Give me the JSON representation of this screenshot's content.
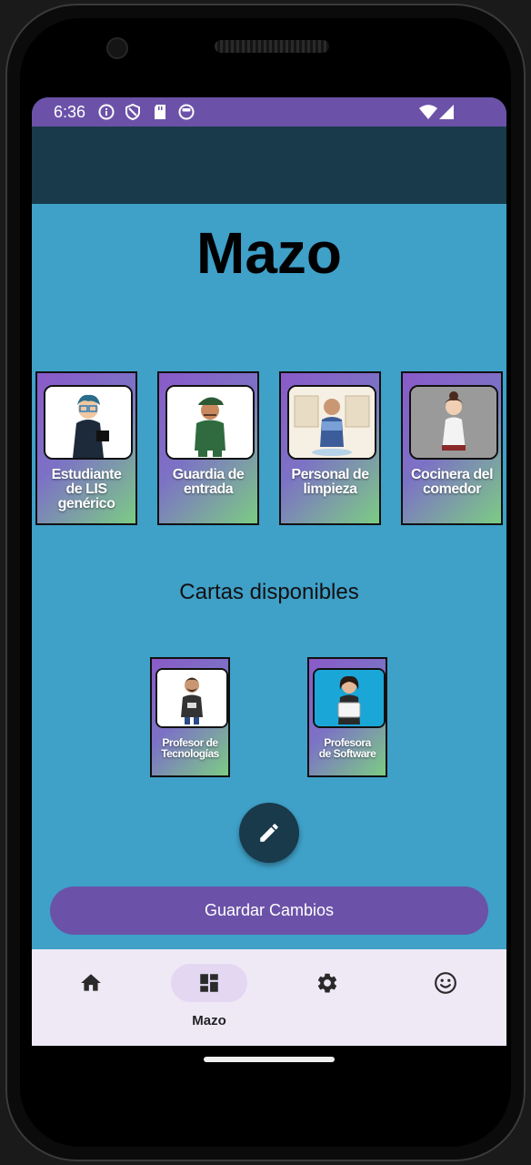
{
  "status_bar": {
    "time": "6:36"
  },
  "page": {
    "title": "Mazo",
    "available_heading": "Cartas disponibles"
  },
  "deck": [
    {
      "label_line1": "Estudiante",
      "label_line2": "de LIS",
      "label_line3": "genérico",
      "icon": "student-character"
    },
    {
      "label_line1": "Guardia de",
      "label_line2": "entrada",
      "label_line3": "",
      "icon": "guard-character"
    },
    {
      "label_line1": "Personal de",
      "label_line2": "limpieza",
      "label_line3": "",
      "icon": "cleaning-staff-character"
    },
    {
      "label_line1": "Cocinera del",
      "label_line2": "comedor",
      "label_line3": "",
      "icon": "cook-character"
    }
  ],
  "available": [
    {
      "label_line1": "Profesor de",
      "label_line2": "Tecnologías",
      "icon": "technology-professor-character"
    },
    {
      "label_line1": "Profesora",
      "label_line2": "de Software",
      "icon": "software-professor-character"
    }
  ],
  "actions": {
    "save_label": "Guardar Cambios",
    "edit_icon": "pencil-icon"
  },
  "bottom_nav": {
    "items": [
      {
        "icon": "home-icon",
        "label": ""
      },
      {
        "icon": "dashboard-icon",
        "label": "Mazo",
        "active": true
      },
      {
        "icon": "gear-icon",
        "label": ""
      },
      {
        "icon": "smiley-icon",
        "label": ""
      }
    ]
  },
  "colors": {
    "status_bar": "#6b52a8",
    "app_bar": "#183a4a",
    "background": "#3fa0c8",
    "button": "#6b52a8",
    "card_gradient_start": "#8a5ac9",
    "card_gradient_end": "#7ccc84",
    "bottom_nav": "#efe9f6"
  }
}
